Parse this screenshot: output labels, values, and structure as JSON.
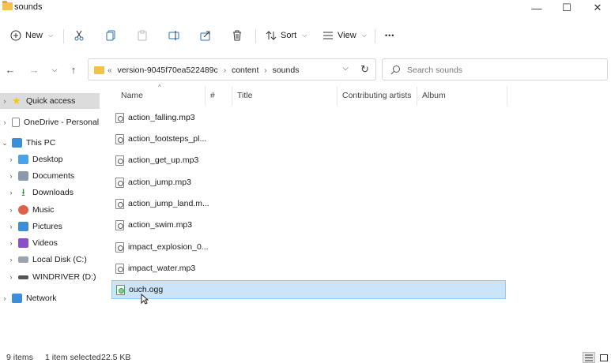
{
  "window": {
    "title": "sounds",
    "minimize_glyph": "—",
    "maximize_glyph": "☐",
    "close_glyph": "✕"
  },
  "toolbar": {
    "new_label": "New",
    "sort_label": "Sort",
    "view_label": "View",
    "more_glyph": "•••"
  },
  "address": {
    "crumbs": [
      "«",
      "version-9045f70ea522489c",
      "›",
      "content",
      "›",
      "sounds"
    ]
  },
  "search": {
    "placeholder": "Search sounds"
  },
  "sidebar": {
    "items": [
      {
        "label": "Quick access",
        "icon": "star-icon",
        "color": "#f5c518"
      },
      {
        "label": "OneDrive - Personal",
        "icon": "document-icon",
        "color": "#8a8a8a"
      },
      {
        "label": "This PC",
        "icon": "computer-icon",
        "color": "#3b8ed8"
      },
      {
        "label": "Desktop",
        "icon": "desktop-icon",
        "color": "#4aa3e8"
      },
      {
        "label": "Documents",
        "icon": "documents-icon",
        "color": "#8a9aac"
      },
      {
        "label": "Downloads",
        "icon": "download-icon",
        "color": "#2c8a3e"
      },
      {
        "label": "Music",
        "icon": "music-icon",
        "color": "#e0614a"
      },
      {
        "label": "Pictures",
        "icon": "pictures-icon",
        "color": "#3c8fd6"
      },
      {
        "label": "Videos",
        "icon": "videos-icon",
        "color": "#8a4fc8"
      },
      {
        "label": "Local Disk (C:)",
        "icon": "disk-icon",
        "color": "#9aa4ae"
      },
      {
        "label": "WINDRIVER (D:)",
        "icon": "drive-icon",
        "color": "#555555"
      },
      {
        "label": "Network",
        "icon": "network-icon",
        "color": "#3b8ed8"
      }
    ]
  },
  "columns": {
    "name": "Name",
    "number": "#",
    "title": "Title",
    "artists": "Contributing artists",
    "album": "Album"
  },
  "files": [
    {
      "name": "action_falling.mp3"
    },
    {
      "name": "action_footsteps_pl..."
    },
    {
      "name": "action_get_up.mp3"
    },
    {
      "name": "action_jump.mp3"
    },
    {
      "name": "action_jump_land.m..."
    },
    {
      "name": "action_swim.mp3"
    },
    {
      "name": "impact_explosion_0..."
    },
    {
      "name": "impact_water.mp3"
    },
    {
      "name": "ouch.ogg"
    }
  ],
  "status": {
    "items": "9 items",
    "selected": "1 item selected",
    "size": "22.5 KB"
  }
}
